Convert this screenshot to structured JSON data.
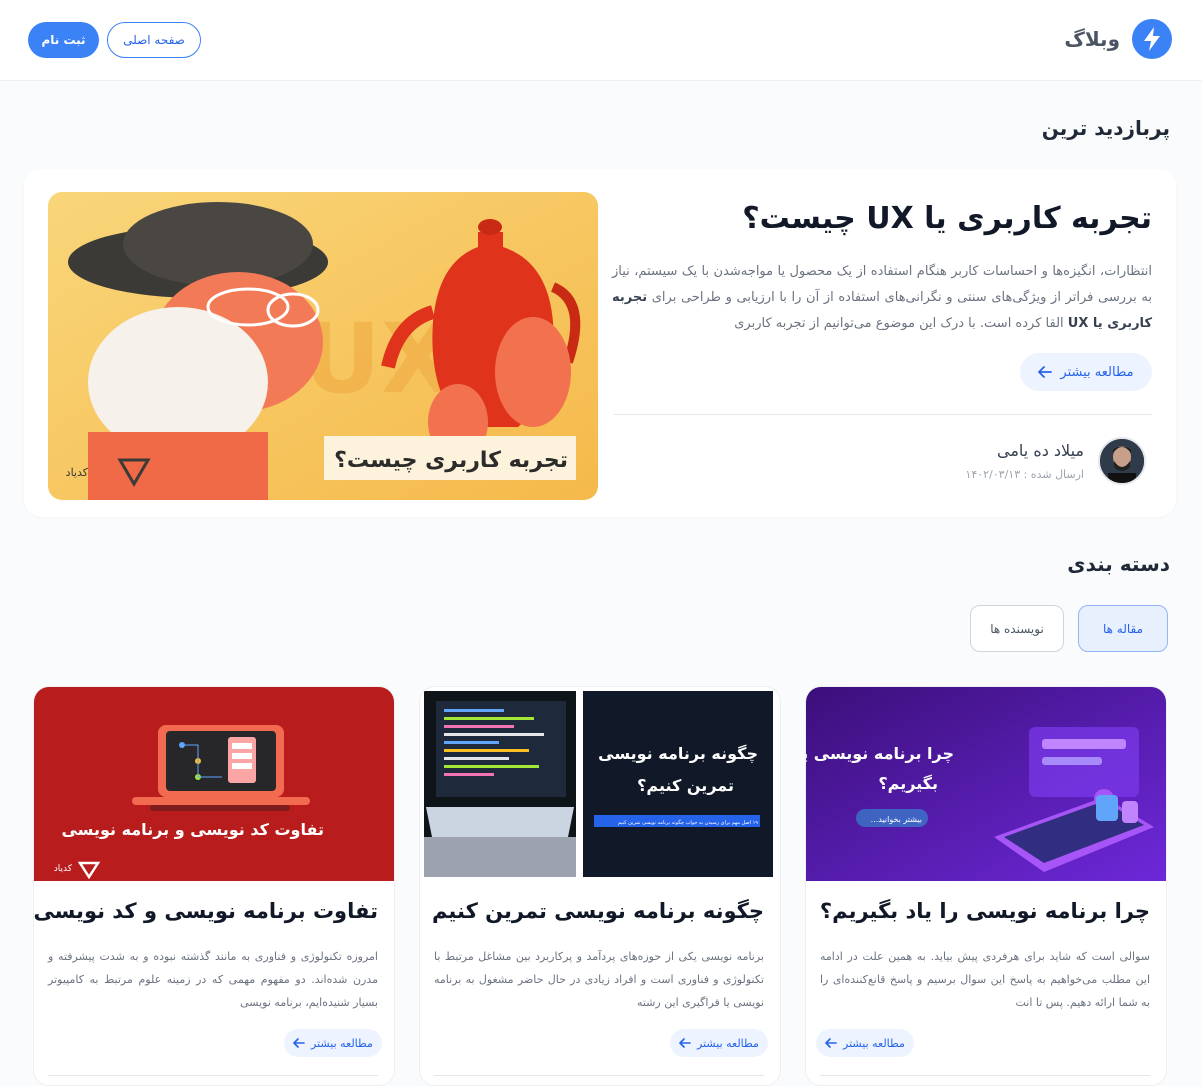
{
  "header": {
    "brand": "وبلاگ",
    "nav_home": "صفحه اصلی",
    "nav_signup": "ثبت نام"
  },
  "popular": {
    "section_title": "پربازدید ترین",
    "title": "تجربه کاربری یا UX چیست؟",
    "excerpt_before": "انتظارات، انگیزه‌ها و احساسات کاربر هنگام استفاده از یک محصول یا مواجه‌شدن با یک سیستم، نیاز به بررسی فراتر از ویژگی‌های سنتی و نگرانی‌های استفاده از آن را با ارزیابی و طراحی برای ",
    "excerpt_bold": "تجربه کاربری یا UX",
    "excerpt_after": " القا کرده است. با درک این موضوع می‌توانیم از تجربه کاربری",
    "read_more": "مطالعه بیشتر",
    "author_name": "میلاد ده یامی",
    "date_label": "ارسال شده :",
    "date_value": "۱۴۰۲/۰۳/۱۳",
    "image_caption": "تجربه کاربری چیست؟",
    "image_bg_text": "UX",
    "image_logo": "کدیاد"
  },
  "categories": {
    "section_title": "دسته بندی",
    "tab_articles": "مقاله ها",
    "tab_authors": "نویسنده ها"
  },
  "posts": [
    {
      "title": "چرا برنامه نویسی را یاد بگیریم؟",
      "excerpt": "سوالی است که شاید برای هرفردی پیش بیاید. به همین علت در ادامه این مطلب می‌خواهیم به پاسخ این سوال برسیم و پاسخ قانع‌کننده‌ای را به شما ارائه دهیم. پس تا انت",
      "read_more": "مطالعه بیشتر",
      "img_caption_1": "چرا برنامه نویسی یاد",
      "img_caption_2": "بگیریم؟",
      "img_button": "بیشتر بخوانید..."
    },
    {
      "title": "چگونه برنامه نویسی تمرین کنیم",
      "excerpt": "برنامه نویسی یکی از حوزه‌های پردآمد و پرکاربرد بین مشاغل مرتبط با تکنولوژی و فناوری است و افراد زیادی در حال حاضر مشغول به برنامه نویسی یا فراگیری این رشته",
      "read_more": "مطالعه بیشتر",
      "img_caption_1": "چگونه برنامه نویسی",
      "img_caption_2": "تمرین کنیم؟",
      "img_strip": "۱۹ اصل مهم برای رسیدن به جواب چگونه برنامه نویسی تمرین کنیم"
    },
    {
      "title": "تفاوت برنامه نویسی و کد نویسی",
      "excerpt": "امروزه تکنولوژی و فناوری به مانند گذشته نبوده و به شدت پیشرفته و مدرن شده‌اند. دو مفهوم مهمی که در زمینه علوم مرتبط به کامپیوتر بسیار شنیده‌ایم، برنامه نویسی",
      "read_more": "مطالعه بیشتر",
      "img_caption": "تفاوت کد نویسی و برنامه نویسی",
      "img_logo": "کدیاد"
    }
  ],
  "colors": {
    "accent": "#3b82f6",
    "card1_bg": "#4c1d95",
    "card3_bg": "#b91c1c",
    "featured_bg": "#f6c35a"
  }
}
